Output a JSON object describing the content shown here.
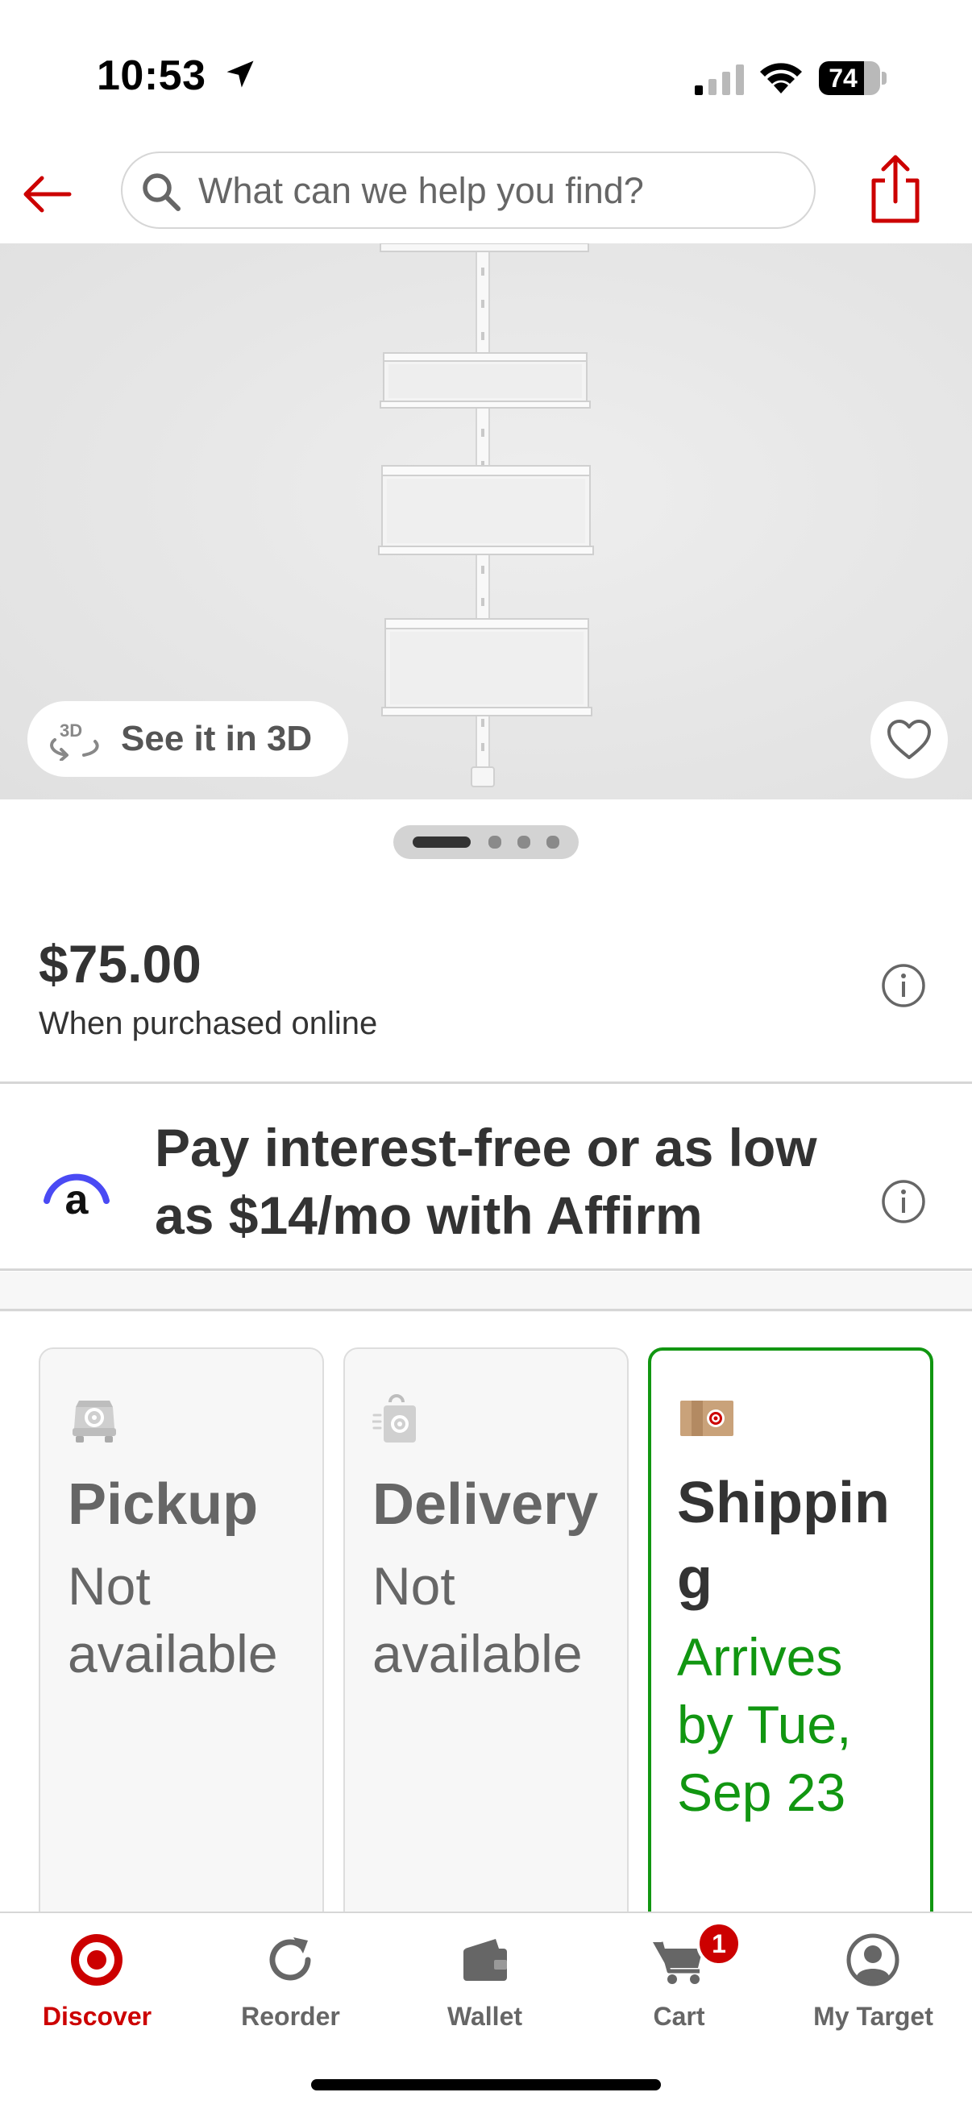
{
  "status_bar": {
    "time": "10:53",
    "battery_level": "74",
    "battery_fraction": 0.74
  },
  "header": {
    "search": {
      "placeholder": "What can we help you find?"
    }
  },
  "hero": {
    "see_3d_label": "See it in 3D",
    "carousel": {
      "total": 4,
      "active_index": 0
    }
  },
  "price": {
    "amount": "$75.00",
    "note": "When purchased online"
  },
  "affirm": {
    "message": "Pay interest-free or as low as $14/mo with Affirm",
    "logo_letter": "a"
  },
  "fulfillment": {
    "options": [
      {
        "title": "Pickup",
        "status": "Not available",
        "state": "disabled",
        "icon": "pickup-icon"
      },
      {
        "title": "Delivery",
        "status": "Not available",
        "state": "disabled",
        "icon": "delivery-icon"
      },
      {
        "title": "Shipping",
        "status": "Arrives by Tue, Sep 23",
        "state": "selected",
        "icon": "shipping-box-icon"
      }
    ]
  },
  "bottom_nav": {
    "items": [
      {
        "label": "Discover",
        "icon": "target-logo-icon",
        "active": true
      },
      {
        "label": "Reorder",
        "icon": "reorder-icon",
        "active": false
      },
      {
        "label": "Wallet",
        "icon": "wallet-icon",
        "active": false
      },
      {
        "label": "Cart",
        "icon": "cart-icon",
        "active": false
      },
      {
        "label": "My Target",
        "icon": "account-icon",
        "active": false
      }
    ],
    "cart_count": "1"
  },
  "colors": {
    "brand_red": "#cc0000",
    "success_green": "#119611",
    "text_primary": "#333333",
    "text_muted": "#666666",
    "affirm_blue": "#4a4af4"
  }
}
